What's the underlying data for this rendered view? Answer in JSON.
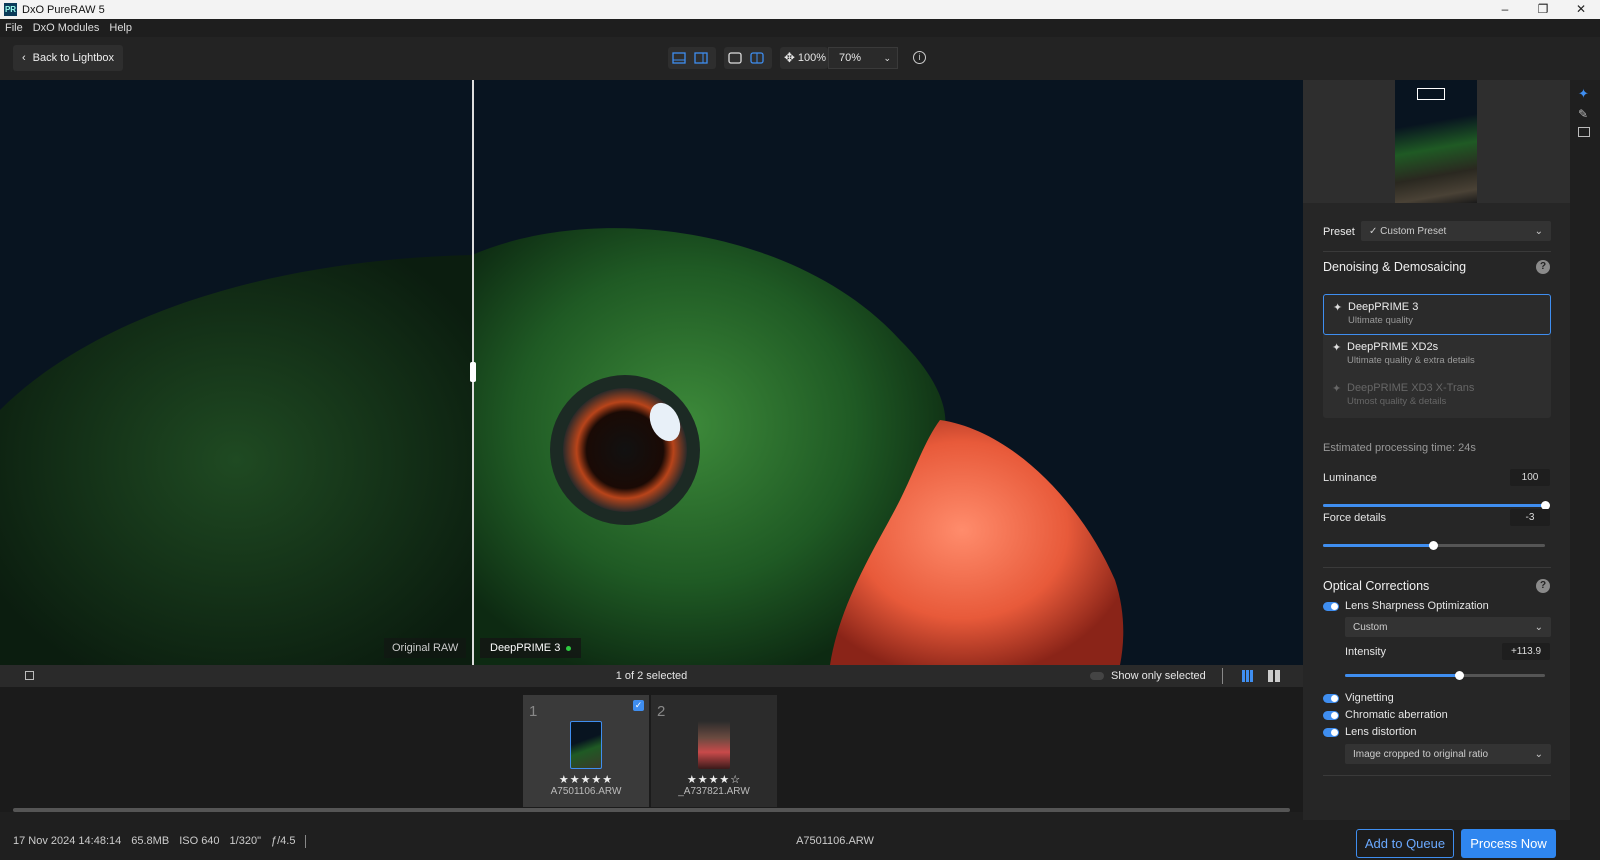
{
  "window": {
    "title": "DxO PureRAW 5",
    "logo": "PR",
    "controls": [
      "–",
      "❐",
      "✕"
    ]
  },
  "menu": [
    "File",
    "DxO Modules",
    "Help"
  ],
  "toolbar": {
    "back_label": "Back to Lightbox",
    "zoom_fit": "100%",
    "zoom_value": "70%"
  },
  "viewer": {
    "left_label": "Original RAW",
    "right_label": "DeepPRIME 3"
  },
  "filmbar": {
    "selection_text": "1 of 2 selected",
    "show_only_selected": "Show only selected"
  },
  "thumbnails": [
    {
      "number": "1",
      "stars": "★★★★★",
      "filename": "A7501106.ARW",
      "selected": true
    },
    {
      "number": "2",
      "stars": "★★★★☆",
      "filename": "_A737821.ARW",
      "selected": false
    }
  ],
  "status": {
    "date": "17 Nov 2024 14:48:14",
    "size": "65.8MB",
    "iso": "ISO 640",
    "shutter": "1/320\"",
    "aperture": "ƒ/4.5",
    "center_filename": "A7501106.ARW",
    "add_queue": "Add to Queue",
    "process_now": "Process Now"
  },
  "panel": {
    "preset_label": "Preset",
    "preset_value": "Custom Preset",
    "denoise_title": "Denoising & Demosaicing",
    "options": [
      {
        "title": "DeepPRIME 3",
        "subtitle": "Ultimate quality"
      },
      {
        "title": "DeepPRIME XD2s",
        "subtitle": "Ultimate quality & extra details"
      },
      {
        "title": "DeepPRIME XD3 X-Trans",
        "subtitle": "Utmost quality & details"
      }
    ],
    "est_time": "Estimated processing time: 24s",
    "luminance_label": "Luminance",
    "luminance_value": "100",
    "force_label": "Force details",
    "force_value": "-3",
    "optical_title": "Optical Corrections",
    "lens_sharp": "Lens Sharpness Optimization",
    "lens_sharp_mode": "Custom",
    "intensity_label": "Intensity",
    "intensity_value": "+113.9",
    "vignetting": "Vignetting",
    "chromatic": "Chromatic aberration",
    "distortion": "Lens distortion",
    "distortion_mode": "Image cropped to original ratio",
    "help": "?"
  },
  "accent_color": "#3f8ef0"
}
